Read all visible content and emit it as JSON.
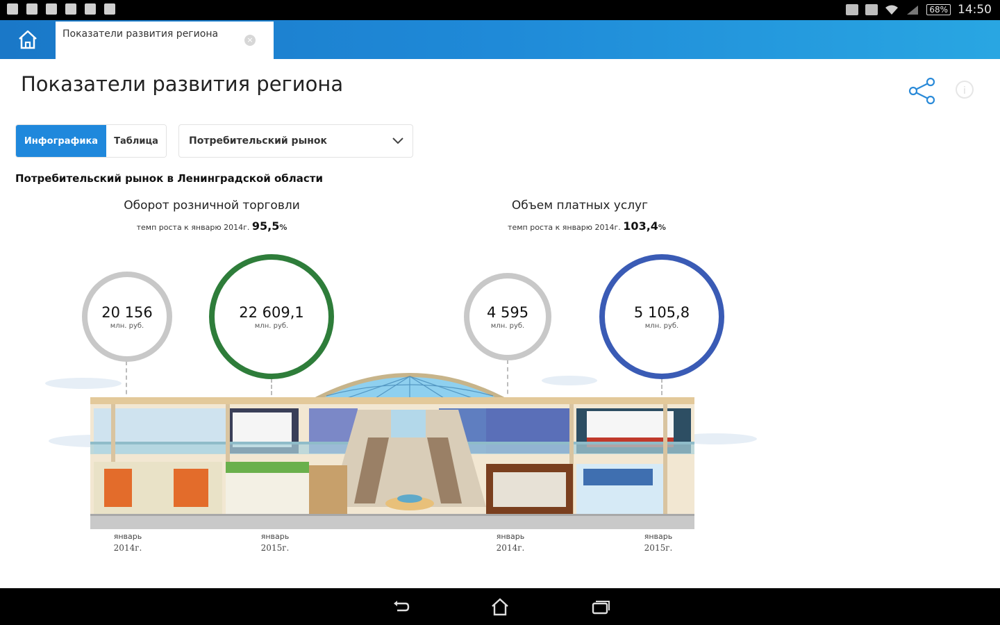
{
  "status_bar": {
    "time": "14:50",
    "battery": "68%"
  },
  "app_bar": {
    "tab_title": "Показатели развития региона",
    "close_label": "×"
  },
  "page": {
    "title": "Показатели развития региона",
    "info_label": "i"
  },
  "view_switch": {
    "active": "Инфографика",
    "inactive": "Таблица"
  },
  "category_select": {
    "selected": "Потребительский рынок"
  },
  "section_title": "Потребительский рынок в Ленинградской области",
  "indicators": [
    {
      "title": "Оборот розничной торговли",
      "growth_prefix": "темп роста к январю 2014г.",
      "growth_value": "95,5",
      "growth_unit": "%",
      "values": [
        {
          "value": "20 156",
          "unit": "млн. руб.",
          "month": "январь",
          "year": "2014г."
        },
        {
          "value": "22 609,1",
          "unit": "млн. руб.",
          "month": "январь",
          "year": "2015г."
        }
      ]
    },
    {
      "title": "Объем платных услуг",
      "growth_prefix": "темп роста к январю 2014г.",
      "growth_value": "103,4",
      "growth_unit": "%",
      "values": [
        {
          "value": "4 595",
          "unit": "млн. руб.",
          "month": "январь",
          "year": "2014г."
        },
        {
          "value": "5 105,8",
          "unit": "млн. руб.",
          "month": "январь",
          "year": "2015г."
        }
      ]
    }
  ],
  "colors": {
    "accent": "#1f88dc",
    "retail_circle": "#2e7d3a",
    "services_circle": "#3a5bb5",
    "base_circle": "#c8c8c8"
  },
  "icons": {
    "home": "home-icon",
    "share": "share-icon",
    "info": "info-icon",
    "dropdown": "chevron-down-icon"
  }
}
